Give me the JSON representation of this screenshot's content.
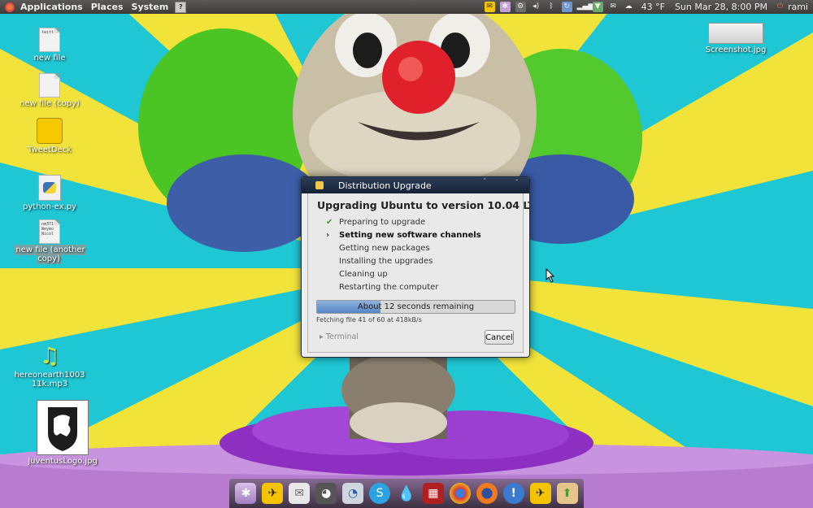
{
  "panel": {
    "menus": [
      "Applications",
      "Places",
      "System"
    ],
    "weather": "43 °F",
    "datetime": "Sun Mar 28,  8:00 PM",
    "user": "rami",
    "tray_icons": [
      "tweetdeck-icon",
      "settings-icon",
      "bluetooth-icon",
      "volume-icon",
      "network-icon",
      "update-icon",
      "signal-icon",
      "download-icon",
      "mail-icon",
      "weather-icon",
      "power-icon"
    ]
  },
  "desktop": {
    "icons": [
      {
        "label": "new file",
        "thumb_text": "twitt"
      },
      {
        "label": "new file (copy)",
        "thumb_text": ""
      },
      {
        "label": "TweetDeck"
      },
      {
        "label": "python-ex.py"
      },
      {
        "label": "new file (another copy)",
        "thumb_text": "nm371\nWeymo\nNicol"
      },
      {
        "label": "hereonearth100311k.mp3"
      },
      {
        "label": "JuventusLogo.jpg"
      },
      {
        "label": "Screenshot.jpg"
      }
    ]
  },
  "dialog": {
    "title": "Distribution Upgrade",
    "heading": "Upgrading Ubuntu to version 10.04 LTS",
    "steps": [
      {
        "label": "Preparing to upgrade",
        "state": "done"
      },
      {
        "label": "Setting new software channels",
        "state": "current"
      },
      {
        "label": "Getting new packages",
        "state": "pending"
      },
      {
        "label": "Installing the upgrades",
        "state": "pending"
      },
      {
        "label": "Cleaning up",
        "state": "pending"
      },
      {
        "label": "Restarting the computer",
        "state": "pending"
      }
    ],
    "progress": {
      "fraction": 0.32,
      "text": "About 12 seconds remaining"
    },
    "status": "Fetching file 41 of 60 at 418kB/s",
    "terminal_label": "Terminal",
    "cancel_label": "Cancel"
  },
  "dock": {
    "items": [
      "settings-icon",
      "tweetdeck-icon",
      "mail-icon",
      "gimp-icon",
      "blender-icon",
      "skype-icon",
      "drop-icon",
      "terminal-icon",
      "chrome-icon",
      "firefox-icon",
      "help-icon",
      "tweetdeck-icon",
      "update-icon"
    ]
  }
}
